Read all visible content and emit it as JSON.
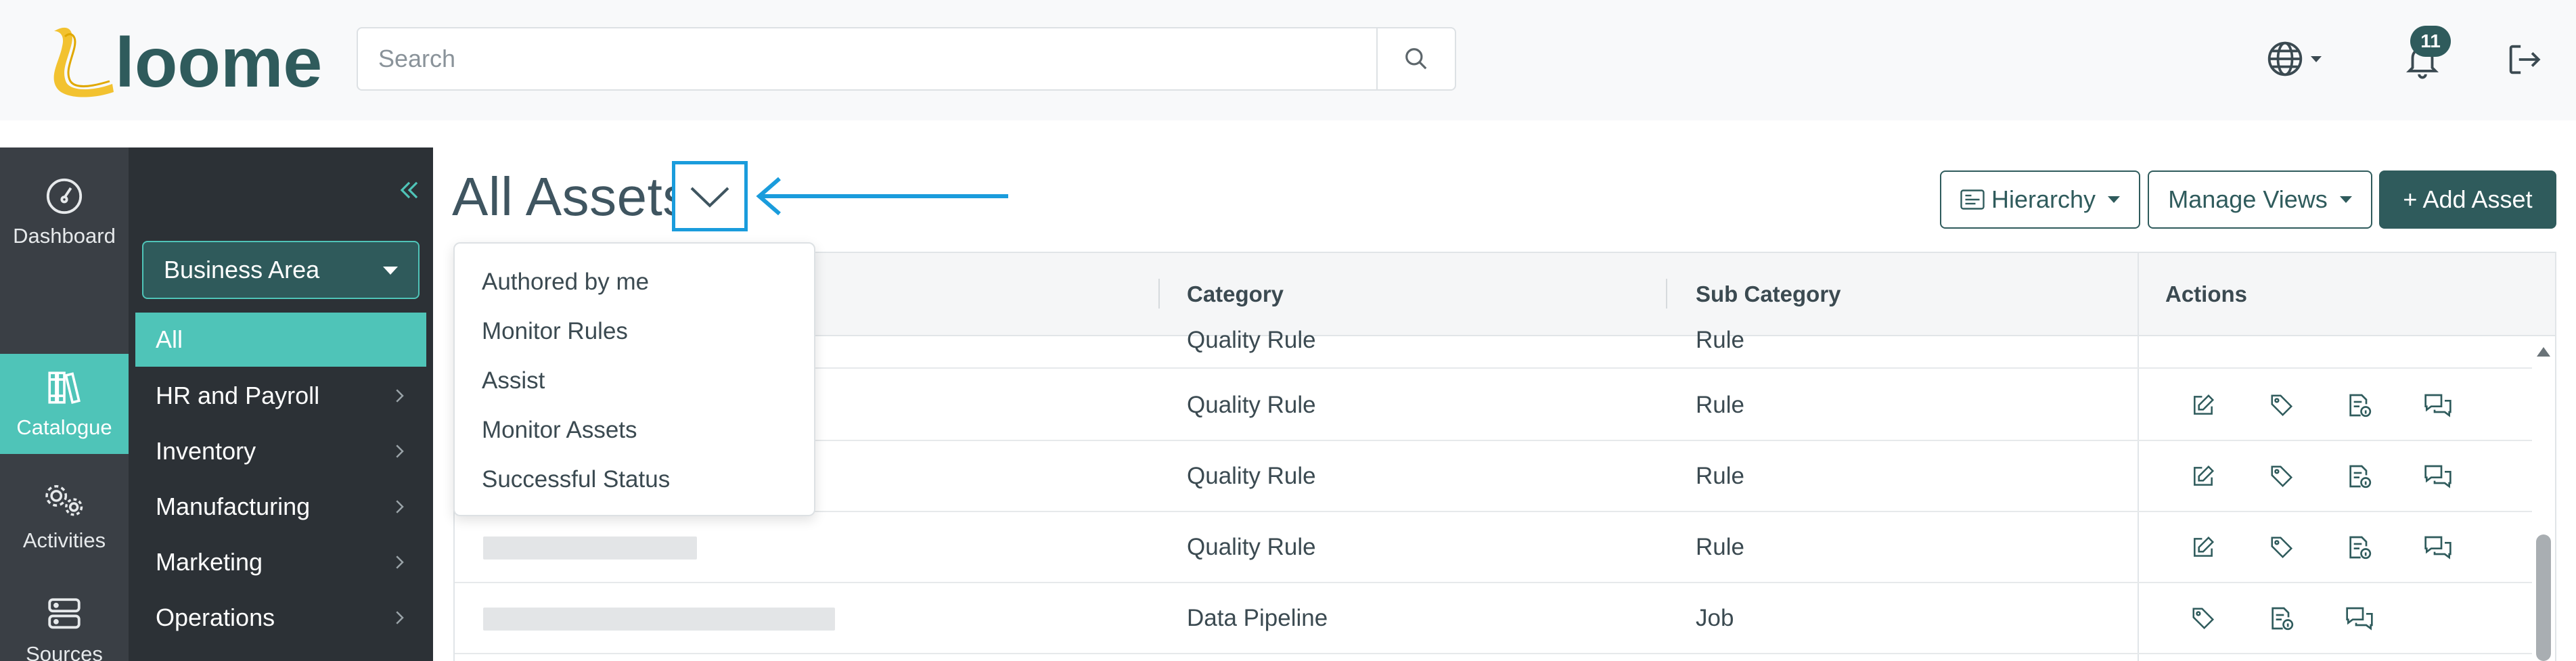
{
  "header": {
    "logo_text": "loome",
    "search_placeholder": "Search",
    "notification_count": "11"
  },
  "rail": {
    "items": [
      {
        "label": "Dashboard",
        "icon": "gauge-icon",
        "active": false
      },
      {
        "label": "Catalogue",
        "icon": "books-icon",
        "active": true
      },
      {
        "label": "Activities",
        "icon": "gears-icon",
        "active": false
      },
      {
        "label": "Sources",
        "icon": "server-icon",
        "active": false
      }
    ]
  },
  "sidebar": {
    "business_area_label": "Business Area",
    "items": [
      {
        "label": "All",
        "active": true,
        "has_children": false
      },
      {
        "label": "HR and Payroll",
        "active": false,
        "has_children": true
      },
      {
        "label": "Inventory",
        "active": false,
        "has_children": true
      },
      {
        "label": "Manufacturing",
        "active": false,
        "has_children": true
      },
      {
        "label": "Marketing",
        "active": false,
        "has_children": true
      },
      {
        "label": "Operations",
        "active": false,
        "has_children": true
      }
    ]
  },
  "main": {
    "title": "All Assets",
    "hierarchy_label": "Hierarchy",
    "manage_views_label": "Manage Views",
    "add_asset_label": "+ Add Asset"
  },
  "views_menu": {
    "items": [
      "Authored by me",
      "Monitor Rules",
      "Assist",
      "Monitor Assets",
      "Successful Status"
    ]
  },
  "table": {
    "columns": {
      "name": "",
      "category": "Category",
      "sub_category": "Sub Category",
      "actions": "Actions"
    },
    "partial_row": {
      "category": "Quality Rule",
      "sub_category": "Rule"
    },
    "rows": [
      {
        "category": "Quality Rule",
        "sub_category": "Rule"
      },
      {
        "category": "Quality Rule",
        "sub_category": "Rule"
      },
      {
        "category": "Quality Rule",
        "sub_category": "Rule"
      },
      {
        "category": "Data Pipeline",
        "sub_category": "Job"
      }
    ]
  },
  "colors": {
    "accent": "#4fc4b8",
    "primary": "#2f5b5c",
    "annotation": "#1a9cdc",
    "rail_bg": "#3a3f45",
    "sidebar_bg": "#2c3136"
  }
}
